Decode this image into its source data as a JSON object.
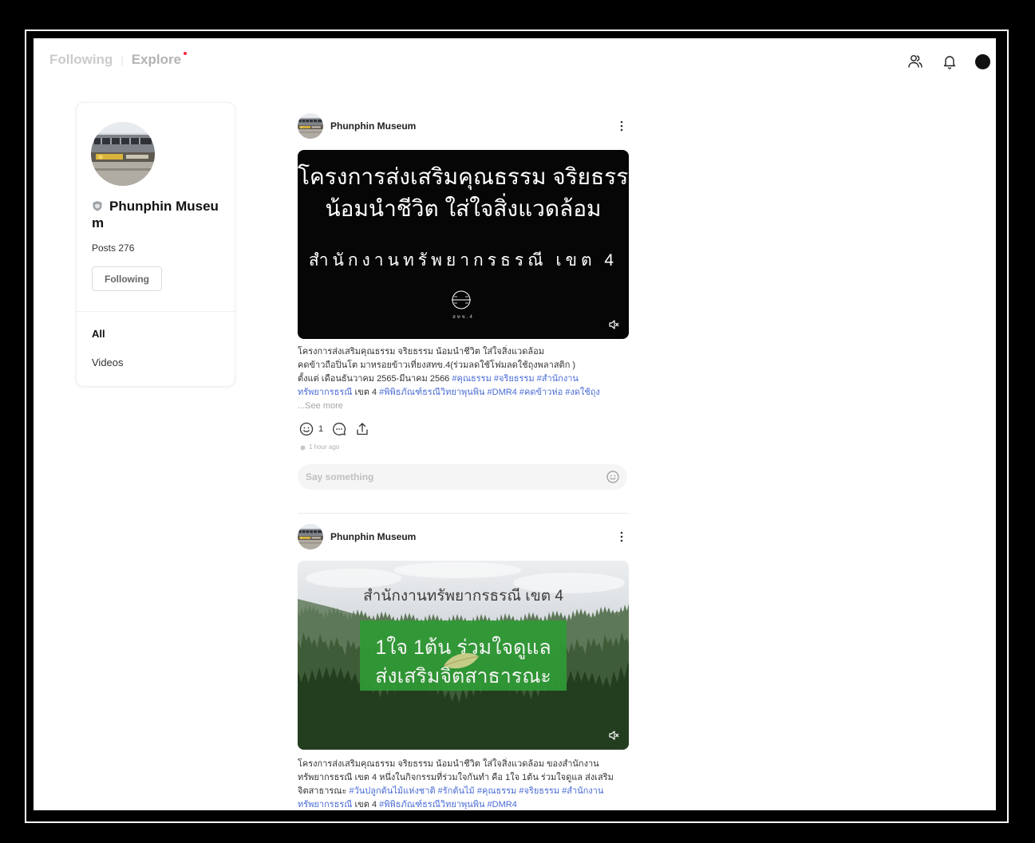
{
  "top_nav": {
    "following": "Following",
    "separator": "|",
    "explore": "Explore"
  },
  "header": {
    "icons": [
      "friends-icon",
      "bell-icon",
      "user-avatar"
    ]
  },
  "profile": {
    "name": "Phunphin Museum",
    "posts_label": "Posts",
    "posts_count": "276",
    "follow_button": "Following",
    "filters": [
      "All",
      "Videos"
    ]
  },
  "posts": [
    {
      "author": "Phunphin Museum",
      "media": {
        "title_lines": [
          "โครงการส่งเสริมคุณธรรม จริยธรรม",
          "น้อมนำชีวิต ใส่ใจสิ่งแวดล้อม"
        ],
        "subtitle": "สำนักงานทรัพยากรธรณี เขต 4",
        "logo_label": "สทข.4"
      },
      "caption_lines": [
        [
          {
            "text": "โครงการส่งเสริมคุณธรรม จริยธรรม น้อมนำชีวิต ใส่ใจสิ่งแวดล้อม"
          }
        ],
        [
          {
            "text": "คดข้าวถือปิ่นโต มาหรอยข้าวเที่ยงสทข.4(ร่วมลดใช้โฟมลดใช้ถุงพลาสติก )"
          }
        ],
        [
          {
            "text": "ตั้งแต่ เดือนธันวาคม 2565-มีนาคม 2566 "
          },
          {
            "hashtag": "#คุณธรรม #จริยธรรม #สำนักงาน"
          }
        ],
        [
          {
            "hashtag": "ทรัพยากรธรณี"
          },
          {
            "text": " เขต 4 "
          },
          {
            "hashtag": "#พิพิธภัณฑ์ธรณีวิทยาพุนพิน #DMR4 #คดข้าวห่อ #งดใช้ถุง"
          }
        ]
      ],
      "see_more": "...See more",
      "reaction_count": "1",
      "time": "1 hour ago",
      "comment_placeholder": "Say something",
      "icons": [
        "smile-icon",
        "comment-icon",
        "share-icon",
        "emoji-icon"
      ]
    },
    {
      "author": "Phunphin Museum",
      "media": {
        "overlay_title": "สำนักงานทรัพยากรธรณี เขต 4",
        "box_lines": [
          "1ใจ 1ต้น ร่วมใจดูแล",
          "ส่งเสริมจิตสาธารณะ"
        ]
      },
      "caption_lines": [
        [
          {
            "text": "โครงการส่งเสริมคุณธรรม จริยธรรม น้อมนำชีวิต ใส่ใจสิ่งแวดล้อม ของสำนักงาน"
          }
        ],
        [
          {
            "text": "ทรัพยากรธรณี เขต 4 หนึ่งในกิจกรรมที่ร่วมใจกันทำ คือ 1ใจ 1ต้น ร่วมใจดูแล ส่งเสริม"
          }
        ],
        [
          {
            "text": "จิตสาธารณะ  "
          },
          {
            "hashtag": "#วันปลูกต้นไม้แห่งชาติ #รักต้นไม้ #คุณธรรม #จริยธรรม #สำนักงาน"
          }
        ],
        [
          {
            "hashtag": "ทรัพยากรธรณี"
          },
          {
            "text": " เขต 4 "
          },
          {
            "hashtag": "#พิพิธภัณฑ์ธรณีวิทยาพุนพิน #DMR4"
          }
        ]
      ]
    }
  ],
  "colors": {
    "hashtag": "#4a6bd6",
    "text": "#333333",
    "muted": "#a5a5a5",
    "explore_dot": "#ff2442",
    "green_box": "#2f9a35"
  }
}
